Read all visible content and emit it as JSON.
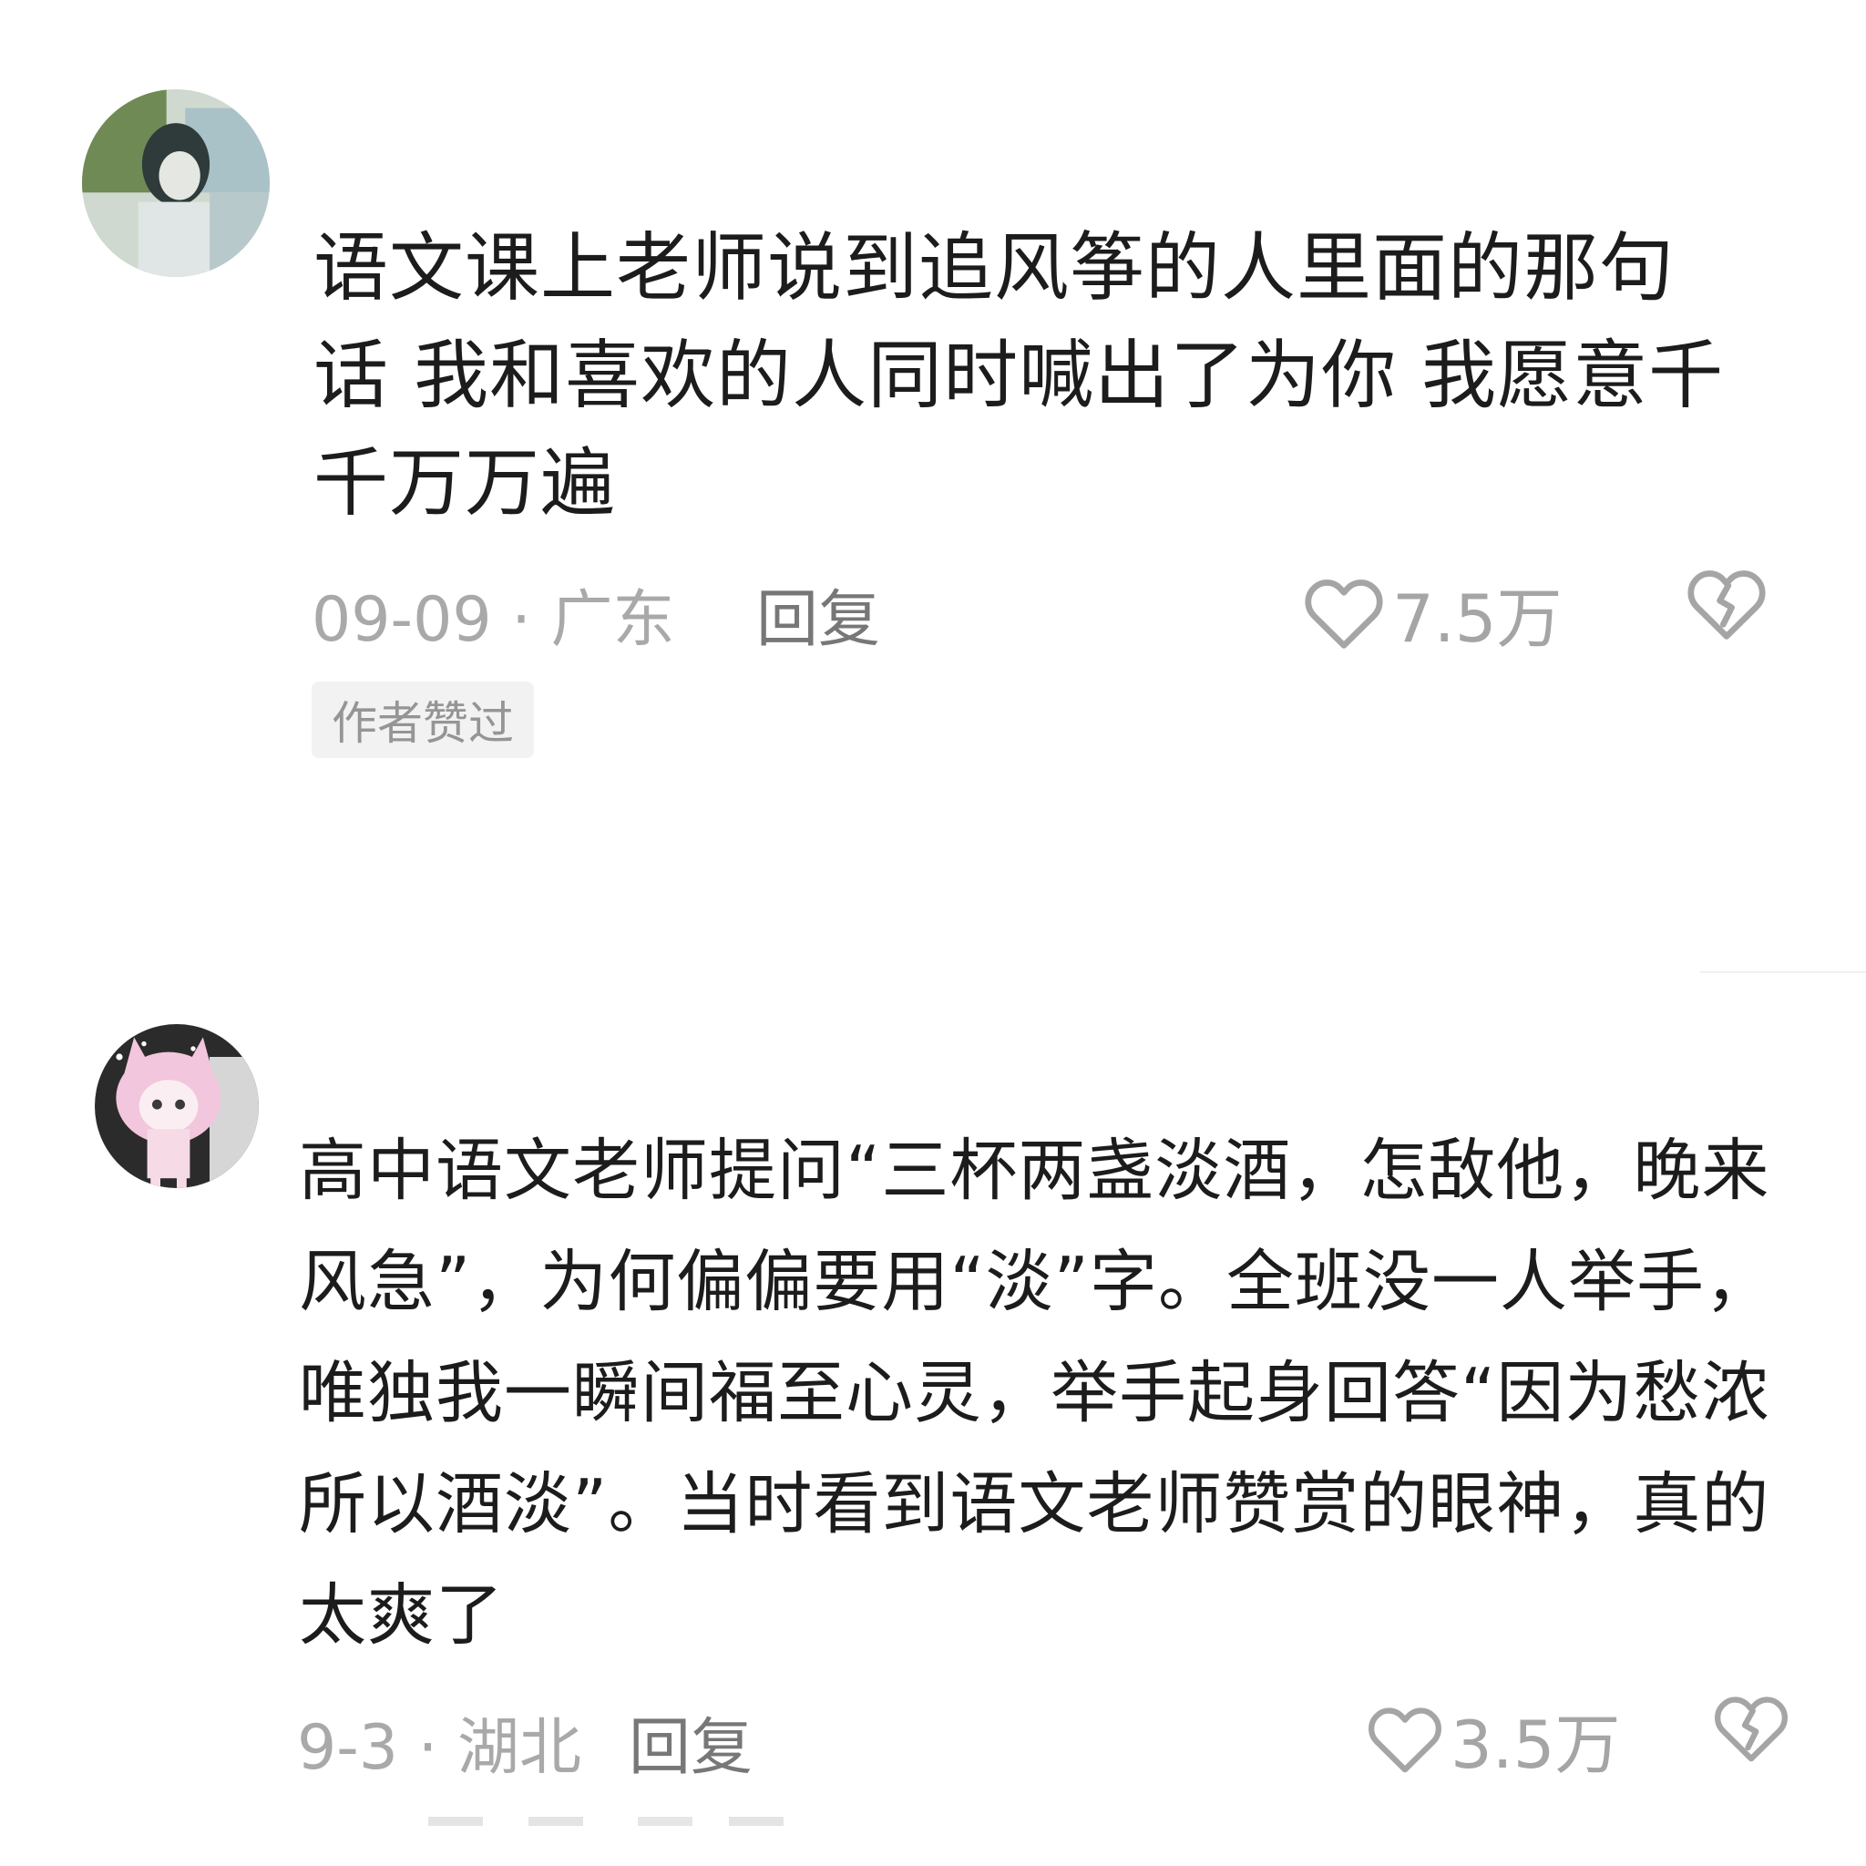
{
  "comments": [
    {
      "avatar_icon": "user-photo-avatar",
      "text": "语文课上老师说到追风筝的人里面的那句\n话 我和喜欢的人同时喊出了为你 我愿意千\n千万万遍",
      "date": "09-09",
      "separator": "·",
      "location": "广东",
      "reply_label": "回复",
      "like_count": "7.5万",
      "author_tag": "作者赞过"
    },
    {
      "avatar_icon": "anime-girl-avatar",
      "text": "高中语文老师提问“三杯两盏淡酒，怎敌他，晚来\n风急”，为何偏偏要用“淡”字。全班没一人举手，\n唯独我一瞬间福至心灵，举手起身回答“因为愁浓\n所以酒淡”。当时看到语文老师赞赏的眼神，真的\n太爽了",
      "date": "9-3",
      "separator": "·",
      "location": "湖北",
      "reply_label": "回复",
      "like_count": "3.5万"
    }
  ],
  "colors": {
    "text": "#1c1c1c",
    "meta": "#a9a9a9",
    "reply": "#777777",
    "tag_bg": "#f2f2f2"
  }
}
